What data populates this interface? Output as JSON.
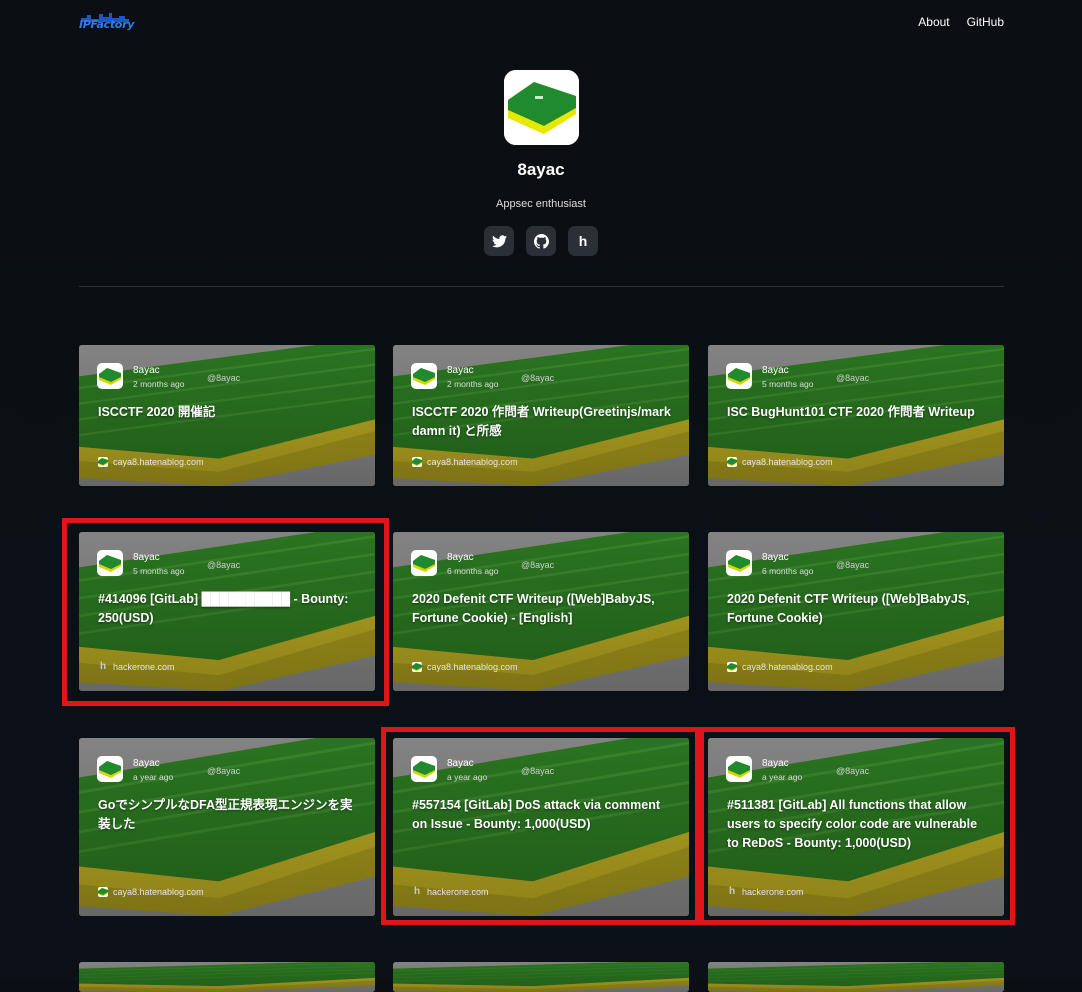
{
  "header": {
    "logo_text": "IPFactory",
    "nav": [
      "About",
      "GitHub"
    ]
  },
  "profile": {
    "name": "8ayac",
    "bio": "Appsec enthusiast",
    "socials": [
      "twitter-icon",
      "github-icon",
      "hackerone-icon"
    ]
  },
  "colors": {
    "highlight": "#e0141b",
    "sponge_green": "#2f7a22",
    "sponge_yellow": "#b4a21a"
  },
  "cards": [
    {
      "author": "8ayac",
      "time": "2 months ago",
      "handle": "@8ayac",
      "title": "ISCCTF 2020 開催記",
      "source": "caya8.hatenablog.com",
      "source_kind": "hatena"
    },
    {
      "author": "8ayac",
      "time": "2 months ago",
      "handle": "@8ayac",
      "title": "ISCCTF 2020 作問者 Writeup(Greetinjs/mark damn it) と所感",
      "source": "caya8.hatenablog.com",
      "source_kind": "hatena"
    },
    {
      "author": "8ayac",
      "time": "5 months ago",
      "handle": "@8ayac",
      "title": "ISC BugHunt101 CTF 2020 作問者 Writeup",
      "source": "caya8.hatenablog.com",
      "source_kind": "hatena"
    },
    {
      "author": "8ayac",
      "time": "5 months ago",
      "handle": "@8ayac",
      "title": "#414096 [GitLab] ██████████ - Bounty: 250(USD)",
      "source": "hackerone.com",
      "source_kind": "hackerone"
    },
    {
      "author": "8ayac",
      "time": "6 months ago",
      "handle": "@8ayac",
      "title": "2020 Defenit CTF Writeup ([Web]BabyJS, Fortune Cookie) - [English]",
      "source": "caya8.hatenablog.com",
      "source_kind": "hatena"
    },
    {
      "author": "8ayac",
      "time": "6 months ago",
      "handle": "@8ayac",
      "title": "2020 Defenit CTF Writeup ([Web]BabyJS, Fortune Cookie)",
      "source": "caya8.hatenablog.com",
      "source_kind": "hatena"
    },
    {
      "author": "8ayac",
      "time": "a year ago",
      "handle": "@8ayac",
      "title": "GoでシンプルなDFA型正規表現エンジンを実装した",
      "source": "caya8.hatenablog.com",
      "source_kind": "hatena"
    },
    {
      "author": "8ayac",
      "time": "a year ago",
      "handle": "@8ayac",
      "title": "#557154 [GitLab] DoS attack via comment on Issue - Bounty: 1,000(USD)",
      "source": "hackerone.com",
      "source_kind": "hackerone"
    },
    {
      "author": "8ayac",
      "time": "a year ago",
      "handle": "@8ayac",
      "title": "#511381 [GitLab] All functions that allow users to specify color code are vulnerable to ReDoS - Bounty: 1,000(USD)",
      "source": "hackerone.com",
      "source_kind": "hackerone"
    }
  ]
}
